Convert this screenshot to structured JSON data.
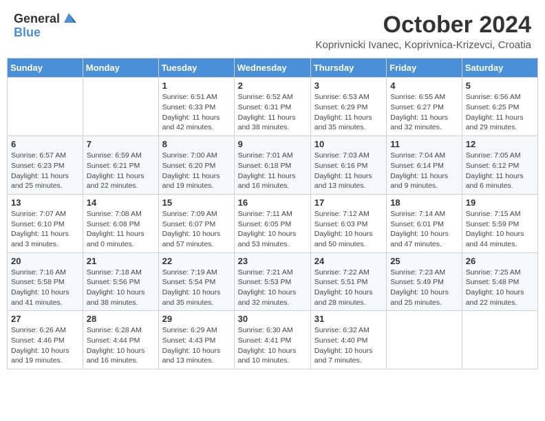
{
  "header": {
    "logo_general": "General",
    "logo_blue": "Blue",
    "month_title": "October 2024",
    "location": "Koprivnicki Ivanec, Koprivnica-Krizevci, Croatia"
  },
  "weekdays": [
    "Sunday",
    "Monday",
    "Tuesday",
    "Wednesday",
    "Thursday",
    "Friday",
    "Saturday"
  ],
  "weeks": [
    [
      {
        "day": "",
        "info": ""
      },
      {
        "day": "",
        "info": ""
      },
      {
        "day": "1",
        "info": "Sunrise: 6:51 AM\nSunset: 6:33 PM\nDaylight: 11 hours and 42 minutes."
      },
      {
        "day": "2",
        "info": "Sunrise: 6:52 AM\nSunset: 6:31 PM\nDaylight: 11 hours and 38 minutes."
      },
      {
        "day": "3",
        "info": "Sunrise: 6:53 AM\nSunset: 6:29 PM\nDaylight: 11 hours and 35 minutes."
      },
      {
        "day": "4",
        "info": "Sunrise: 6:55 AM\nSunset: 6:27 PM\nDaylight: 11 hours and 32 minutes."
      },
      {
        "day": "5",
        "info": "Sunrise: 6:56 AM\nSunset: 6:25 PM\nDaylight: 11 hours and 29 minutes."
      }
    ],
    [
      {
        "day": "6",
        "info": "Sunrise: 6:57 AM\nSunset: 6:23 PM\nDaylight: 11 hours and 25 minutes."
      },
      {
        "day": "7",
        "info": "Sunrise: 6:59 AM\nSunset: 6:21 PM\nDaylight: 11 hours and 22 minutes."
      },
      {
        "day": "8",
        "info": "Sunrise: 7:00 AM\nSunset: 6:20 PM\nDaylight: 11 hours and 19 minutes."
      },
      {
        "day": "9",
        "info": "Sunrise: 7:01 AM\nSunset: 6:18 PM\nDaylight: 11 hours and 16 minutes."
      },
      {
        "day": "10",
        "info": "Sunrise: 7:03 AM\nSunset: 6:16 PM\nDaylight: 11 hours and 13 minutes."
      },
      {
        "day": "11",
        "info": "Sunrise: 7:04 AM\nSunset: 6:14 PM\nDaylight: 11 hours and 9 minutes."
      },
      {
        "day": "12",
        "info": "Sunrise: 7:05 AM\nSunset: 6:12 PM\nDaylight: 11 hours and 6 minutes."
      }
    ],
    [
      {
        "day": "13",
        "info": "Sunrise: 7:07 AM\nSunset: 6:10 PM\nDaylight: 11 hours and 3 minutes."
      },
      {
        "day": "14",
        "info": "Sunrise: 7:08 AM\nSunset: 6:08 PM\nDaylight: 11 hours and 0 minutes."
      },
      {
        "day": "15",
        "info": "Sunrise: 7:09 AM\nSunset: 6:07 PM\nDaylight: 10 hours and 57 minutes."
      },
      {
        "day": "16",
        "info": "Sunrise: 7:11 AM\nSunset: 6:05 PM\nDaylight: 10 hours and 53 minutes."
      },
      {
        "day": "17",
        "info": "Sunrise: 7:12 AM\nSunset: 6:03 PM\nDaylight: 10 hours and 50 minutes."
      },
      {
        "day": "18",
        "info": "Sunrise: 7:14 AM\nSunset: 6:01 PM\nDaylight: 10 hours and 47 minutes."
      },
      {
        "day": "19",
        "info": "Sunrise: 7:15 AM\nSunset: 5:59 PM\nDaylight: 10 hours and 44 minutes."
      }
    ],
    [
      {
        "day": "20",
        "info": "Sunrise: 7:16 AM\nSunset: 5:58 PM\nDaylight: 10 hours and 41 minutes."
      },
      {
        "day": "21",
        "info": "Sunrise: 7:18 AM\nSunset: 5:56 PM\nDaylight: 10 hours and 38 minutes."
      },
      {
        "day": "22",
        "info": "Sunrise: 7:19 AM\nSunset: 5:54 PM\nDaylight: 10 hours and 35 minutes."
      },
      {
        "day": "23",
        "info": "Sunrise: 7:21 AM\nSunset: 5:53 PM\nDaylight: 10 hours and 32 minutes."
      },
      {
        "day": "24",
        "info": "Sunrise: 7:22 AM\nSunset: 5:51 PM\nDaylight: 10 hours and 28 minutes."
      },
      {
        "day": "25",
        "info": "Sunrise: 7:23 AM\nSunset: 5:49 PM\nDaylight: 10 hours and 25 minutes."
      },
      {
        "day": "26",
        "info": "Sunrise: 7:25 AM\nSunset: 5:48 PM\nDaylight: 10 hours and 22 minutes."
      }
    ],
    [
      {
        "day": "27",
        "info": "Sunrise: 6:26 AM\nSunset: 4:46 PM\nDaylight: 10 hours and 19 minutes."
      },
      {
        "day": "28",
        "info": "Sunrise: 6:28 AM\nSunset: 4:44 PM\nDaylight: 10 hours and 16 minutes."
      },
      {
        "day": "29",
        "info": "Sunrise: 6:29 AM\nSunset: 4:43 PM\nDaylight: 10 hours and 13 minutes."
      },
      {
        "day": "30",
        "info": "Sunrise: 6:30 AM\nSunset: 4:41 PM\nDaylight: 10 hours and 10 minutes."
      },
      {
        "day": "31",
        "info": "Sunrise: 6:32 AM\nSunset: 4:40 PM\nDaylight: 10 hours and 7 minutes."
      },
      {
        "day": "",
        "info": ""
      },
      {
        "day": "",
        "info": ""
      }
    ]
  ]
}
